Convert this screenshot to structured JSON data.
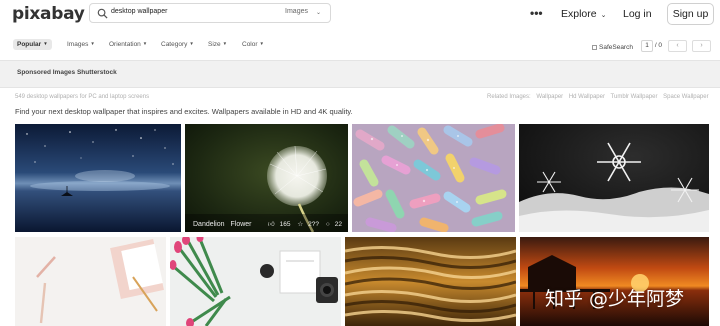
{
  "header": {
    "logo": "pixabay",
    "search_value": "desktop wallpaper",
    "search_type": "Images",
    "more_label": "•••",
    "explore_label": "Explore",
    "login_label": "Log in",
    "signup_label": "Sign up"
  },
  "filters": {
    "items": [
      "Popular",
      "Images",
      "Orientation",
      "Category",
      "Size",
      "Color"
    ],
    "safesearch_label": "SafeSearch",
    "page_current": "1",
    "page_total": "/ 0",
    "prev_icon": "‹",
    "next_icon": "›"
  },
  "sponsored_label": "Sponsored Images Shutterstock",
  "results": {
    "count_text": "549 desktop wallpapers for PC and laptop screens",
    "related_label": "Related Images:",
    "related_tags": [
      "Wallpaper",
      "Hd Wallpaper",
      "Tumblr Wallpaper",
      "Space Wallpaper"
    ],
    "tagline": "Find your next desktop wallpaper that inspires and excites. Wallpapers available in HD and 4K quality."
  },
  "hovered_image": {
    "tags": [
      "Dandelion",
      "Flower"
    ],
    "likes": "165",
    "favorites": "2??",
    "comments": "22"
  },
  "watermark": "知乎 @少年阿梦",
  "colors": {
    "accent": "#222222",
    "filter_active_bg": "#e8e8e8",
    "sponsored_bg": "#f1f1f1"
  }
}
